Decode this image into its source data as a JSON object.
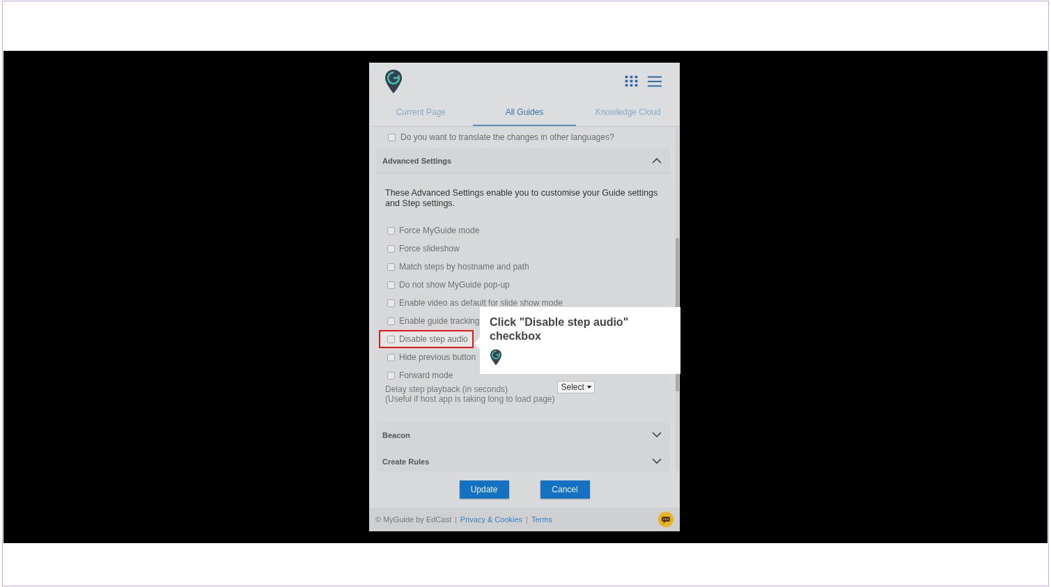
{
  "tabs": [
    {
      "label": "Current Page",
      "selected": false
    },
    {
      "label": "All Guides",
      "selected": true
    },
    {
      "label": "Knowledge Cloud",
      "selected": false
    }
  ],
  "translate_option": {
    "label": "Do you want to translate the changes in other languages?",
    "checked": false
  },
  "sections": [
    {
      "title": "Advanced Settings",
      "expanded": true,
      "description": "These Advanced Settings enable you to customise your Guide settings and Step settings.",
      "options": [
        {
          "label": "Force MyGuide mode",
          "checked": false,
          "highlighted": false
        },
        {
          "label": "Force slideshow",
          "checked": false,
          "highlighted": false
        },
        {
          "label": "Match steps by hostname and path",
          "checked": false,
          "highlighted": false
        },
        {
          "label": "Do not show MyGuide pop-up",
          "checked": false,
          "highlighted": false
        },
        {
          "label": "Enable video as default for slide show mode",
          "checked": false,
          "highlighted": false
        },
        {
          "label": "Enable guide tracking",
          "checked": false,
          "highlighted": false
        },
        {
          "label": "Disable step audio",
          "checked": false,
          "highlighted": true
        },
        {
          "label": "Hide previous button",
          "checked": false,
          "highlighted": false
        },
        {
          "label": "Forward mode",
          "checked": false,
          "highlighted": false
        }
      ],
      "delay": {
        "label": "Delay step playback (in seconds)",
        "hint": "(Useful if host app is taking long to load page)",
        "select": "Select"
      }
    },
    {
      "title": "Beacon",
      "expanded": false
    },
    {
      "title": "Create Rules",
      "expanded": false
    }
  ],
  "buttons": [
    "Update",
    "Cancel"
  ],
  "footer": {
    "copyright": "© MyGuide by EdCast",
    "links": [
      {
        "separator": "|",
        "label": "Privacy & Cookies"
      },
      {
        "separator": "|",
        "label": "Terms"
      }
    ]
  },
  "tooltip": {
    "text": "Click \"Disable step audio\" checkbox"
  }
}
